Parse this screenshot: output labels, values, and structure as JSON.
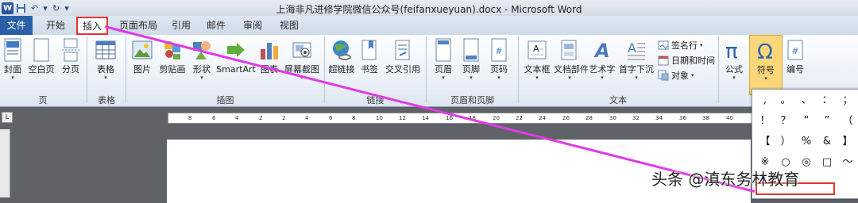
{
  "window": {
    "title": "上海非凡进修学院微信公众号(feifanxueyuan).docx - Microsoft Word",
    "qat": [
      {
        "name": "word-logo-icon",
        "glyph": "W"
      },
      {
        "name": "save-icon",
        "glyph": "💾"
      },
      {
        "name": "undo-icon",
        "glyph": "↶"
      },
      {
        "name": "undo-dropdown-icon",
        "glyph": "▾"
      },
      {
        "name": "redo-icon",
        "glyph": "↻"
      },
      {
        "name": "customize-qat-icon",
        "glyph": "▾"
      }
    ]
  },
  "tabs": {
    "file": "文件",
    "start": "开始",
    "insert": "插入",
    "page_layout": "页面布局",
    "references": "引用",
    "mailings": "邮件",
    "review": "审阅",
    "view": "视图"
  },
  "ribbon": {
    "pages": {
      "cover": "封面",
      "blank": "空白页",
      "break": "分页",
      "label": "页"
    },
    "tables": {
      "table": "表格",
      "label": "表格"
    },
    "illustrations": {
      "picture": "图片",
      "clipart": "剪贴画",
      "shapes": "形状",
      "smartart": "SmartArt",
      "chart": "图表",
      "screenshot": "屏幕截图",
      "label": "插图"
    },
    "links": {
      "hyperlink": "超链接",
      "bookmark": "书签",
      "crossref": "交叉引用",
      "label": "链接"
    },
    "header_footer": {
      "header": "页眉",
      "footer": "页脚",
      "page_number": "页码",
      "label": "页眉和页脚"
    },
    "text": {
      "textbox": "文本框",
      "quickparts": "文档部件",
      "wordart": "艺术字",
      "dropcap": "首字下沉",
      "signature": "签名行",
      "datetime": "日期和时间",
      "object": "对象",
      "label": "文本"
    },
    "symbols": {
      "equation": "公式",
      "symbol": "符号",
      "numbering": "编号"
    }
  },
  "ruler": {
    "ticks": [
      "8",
      "6",
      "4",
      "2",
      "2",
      "4",
      "6",
      "8",
      "10",
      "12",
      "14",
      "16",
      "18",
      "20",
      "22",
      "24",
      "26",
      "28",
      "30",
      "32",
      "34",
      "36",
      "38",
      "40"
    ]
  },
  "symbol_panel": {
    "rows": [
      [
        ",",
        "。",
        "、",
        "：",
        "；"
      ],
      [
        "！",
        "？",
        "“",
        "”",
        "（"
      ],
      [
        "【",
        "）",
        "%",
        "&",
        "】"
      ],
      [
        "※",
        "○",
        "◎",
        "□",
        "～"
      ]
    ]
  },
  "watermark": "头条 @滇东务林教育",
  "colors": {
    "annotation_line": "#e03ae6",
    "highlight_box": "#e53333",
    "file_tab": "#2a5fa8"
  }
}
